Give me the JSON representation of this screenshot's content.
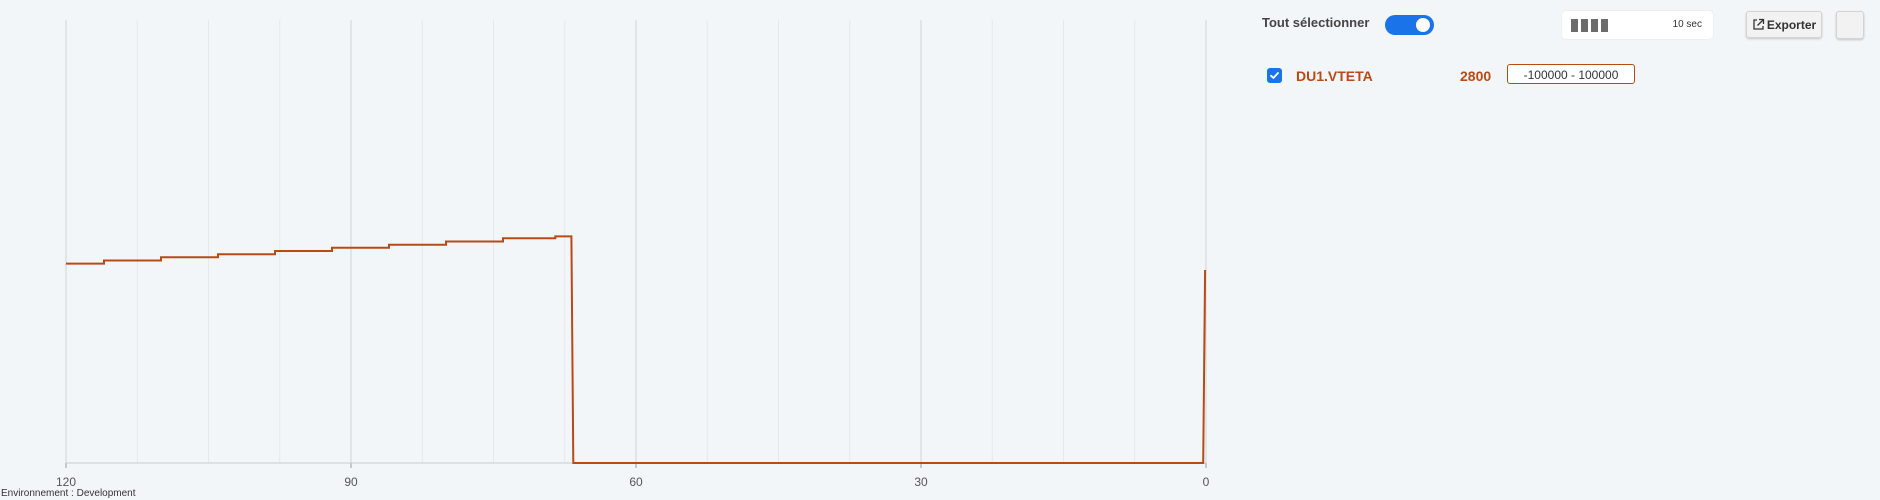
{
  "environment_label": "Environnement : Development",
  "controls": {
    "select_all_label": "Tout sélectionner",
    "select_all_on": true,
    "refresh_label": "10 sec",
    "export_label": "Exporter"
  },
  "series_list": [
    {
      "name": "DU1.VTETA",
      "value": "2800",
      "range": "-100000 - 100000",
      "checked": true,
      "color": "#b84a14"
    }
  ],
  "chart_data": {
    "type": "line",
    "x_reversed": true,
    "xlim": [
      120,
      0
    ],
    "x_ticks": [
      120,
      90,
      60,
      30,
      0
    ],
    "grid": "vertical",
    "series": [
      {
        "color": "#b84a14",
        "points": [
          [
            120,
            1150
          ],
          [
            116,
            1150
          ],
          [
            116,
            1200
          ],
          [
            110,
            1200
          ],
          [
            110,
            1250
          ],
          [
            104,
            1250
          ],
          [
            104,
            1300
          ],
          [
            98,
            1300
          ],
          [
            98,
            1350
          ],
          [
            92,
            1350
          ],
          [
            92,
            1400
          ],
          [
            86,
            1400
          ],
          [
            86,
            1450
          ],
          [
            80,
            1450
          ],
          [
            80,
            1500
          ],
          [
            74,
            1500
          ],
          [
            74,
            1550
          ],
          [
            68.5,
            1550
          ],
          [
            68.5,
            1580
          ],
          [
            66.8,
            1580
          ],
          [
            66.6,
            -2000
          ],
          [
            0.3,
            -2000
          ],
          [
            0.1,
            1050
          ]
        ]
      }
    ]
  }
}
